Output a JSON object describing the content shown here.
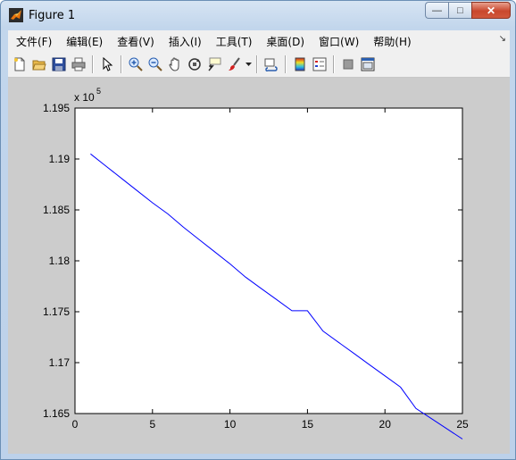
{
  "window": {
    "title": "Figure 1",
    "buttons": {
      "minimize": "—",
      "maximize": "□",
      "close": "✕"
    }
  },
  "menu": {
    "items": [
      {
        "label": "文件(F)"
      },
      {
        "label": "编辑(E)"
      },
      {
        "label": "查看(V)"
      },
      {
        "label": "插入(I)"
      },
      {
        "label": "工具(T)"
      },
      {
        "label": "桌面(D)"
      },
      {
        "label": "窗口(W)"
      },
      {
        "label": "帮助(H)"
      }
    ],
    "dock_glyph": "↘"
  },
  "toolbar": {
    "icons": [
      "new-figure-icon",
      "open-file-icon",
      "save-icon",
      "print-icon",
      "pointer-icon",
      "zoom-in-icon",
      "zoom-out-icon",
      "pan-hand-icon",
      "rotate-3d-icon",
      "data-cursor-icon",
      "brush-icon",
      "brush-dropdown-icon",
      "link-plot-icon",
      "colorbar-icon",
      "legend-icon",
      "hide-plot-tools-icon",
      "show-plot-tools-icon"
    ]
  },
  "chart_data": {
    "type": "line",
    "title": "",
    "xlabel": "",
    "ylabel": "",
    "exponent_label": "x 10",
    "exponent_power": "5",
    "xlim": [
      0,
      25
    ],
    "ylim": [
      1.165,
      1.195
    ],
    "xticks": [
      "0",
      "5",
      "10",
      "15",
      "20",
      "25"
    ],
    "yticks": [
      "1.165",
      "1.17",
      "1.175",
      "1.18",
      "1.185",
      "1.19",
      "1.195"
    ],
    "grid": false,
    "series": [
      {
        "color": "#0000ff",
        "x": [
          1,
          2,
          3,
          4,
          5,
          6,
          7,
          8,
          9,
          10,
          11,
          12,
          13,
          14,
          15,
          16,
          17,
          18,
          19,
          20,
          21,
          22,
          23,
          24,
          25
        ],
        "y": [
          1.1905,
          1.1893,
          1.1881,
          1.1869,
          1.1857,
          1.1846,
          1.1833,
          1.1821,
          1.1809,
          1.1797,
          1.1784,
          1.1773,
          1.1762,
          1.1751,
          1.1751,
          1.1731,
          1.172,
          1.1709,
          1.1698,
          1.1687,
          1.1676,
          1.1655,
          1.1645,
          1.1635,
          1.1625
        ]
      }
    ]
  },
  "colors": {
    "figure_background": "#cccccc",
    "axes_background": "#ffffff",
    "line": "#0000ff"
  }
}
